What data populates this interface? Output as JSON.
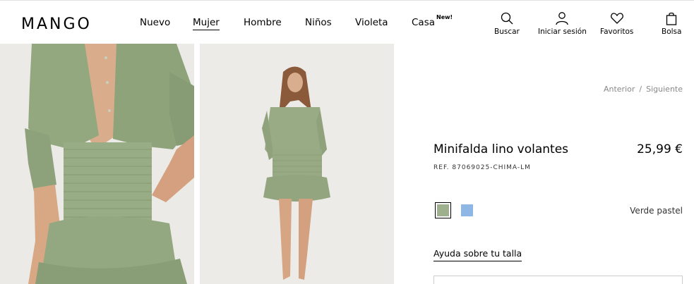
{
  "brand": {
    "logo": "MANGO"
  },
  "nav": {
    "items": [
      {
        "label": "Nuevo"
      },
      {
        "label": "Mujer",
        "active": true
      },
      {
        "label": "Hombre"
      },
      {
        "label": "Niños"
      },
      {
        "label": "Violeta"
      },
      {
        "label": "Casa",
        "badge": "New!"
      }
    ]
  },
  "utilities": {
    "search": {
      "label": "Buscar",
      "icon": "search-icon"
    },
    "login": {
      "label": "Iniciar sesión",
      "icon": "user-icon"
    },
    "favorites": {
      "label": "Favoritos",
      "icon": "heart-icon"
    },
    "bag": {
      "label": "Bolsa",
      "icon": "bag-icon"
    }
  },
  "pager": {
    "previous": "Anterior",
    "separator": "/",
    "next": "Siguiente"
  },
  "product": {
    "name": "Minifalda lino volantes",
    "price": "25,99 €",
    "reference": "REF. 87069025-CHIMA-LM",
    "selected_color": "Verde pastel",
    "swatches": [
      {
        "name": "green-swatch",
        "color": "#9fb08e",
        "selected": true
      },
      {
        "name": "blue-swatch",
        "color": "#8fb7e6",
        "selected": false
      }
    ],
    "size_help": "Ayuda sobre tu talla"
  },
  "colors": {
    "accent": "#000000",
    "muted_text": "#888888",
    "product_green": "#9fb08e"
  }
}
